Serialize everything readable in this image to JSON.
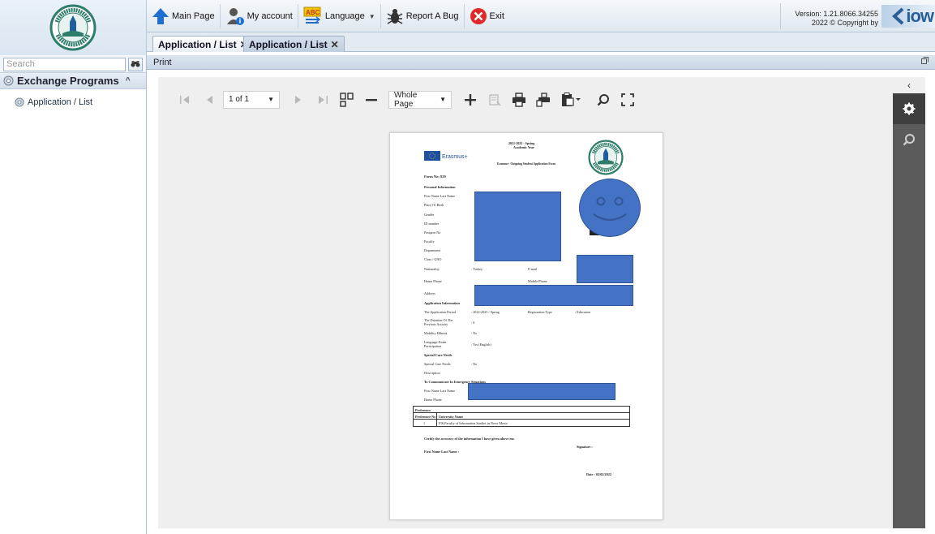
{
  "sidebar": {
    "search_placeholder": "Search",
    "group_label": "Exchange Programs",
    "item_label": "Application /  List"
  },
  "toolbar": {
    "main_page": "Main Page",
    "my_account": "My account",
    "language": "Language",
    "report_bug": "Report A Bug",
    "exit": "Exit"
  },
  "version": {
    "line1": "Version: 1.21.8066.34255",
    "line2": "2022 © Copyright by",
    "brand": "iow"
  },
  "tabs": [
    {
      "label": "Application / List",
      "close": "✕"
    },
    {
      "label": "Application / List",
      "close": "✕"
    }
  ],
  "panel": {
    "title": "Print",
    "close_icon": "restore-icon"
  },
  "viewer": {
    "page_indicator": "1 of 1",
    "zoom_option": "Whole Page"
  },
  "document": {
    "header_line1": "2021-2022 - Spring",
    "header_line2": "Academic Year",
    "erasmus": "Erasmus+",
    "form_title": "Erasmus+ Outgoing Student Application Form",
    "form_no": "Form No: 929",
    "personal_info": "Personal Information",
    "labels": [
      "First Name Last Name",
      "Place Of Birth",
      "Gender",
      "ID number",
      "Passport No",
      "Faculty",
      "Department",
      "Class / GNO"
    ],
    "nationality_label": "Nationality",
    "nationality_value": ": Turkey",
    "email_label": "E-mail",
    "home_phone_label": "Home Phone",
    "mobile_phone_label": "Mobile Phone",
    "address_label": "Address",
    "application_info": "Application Information",
    "app_period_label": "The Application Period",
    "app_period_value": ": 2022-2023 / Spring",
    "reg_type_label": "Registration Type",
    "reg_type_value": ": Education",
    "duration_label_1": "The Duration Of The",
    "duration_label_2": "Previous Activity",
    "duration_value": ": 0",
    "mobility_label": "Mobility Hibesiz",
    "mobility_value": ": No",
    "lang_exam_label_1": "Language Exam",
    "lang_exam_label_2": "Participation",
    "lang_exam_value": ": Yes (English)",
    "special_care_header": "Special Care Needs",
    "special_care_label": "Special Care Needs",
    "special_care_value": ": No",
    "description_label": "Description",
    "emergency_header": "To Communicate In Emergency Situations",
    "emergency_name_label": "First Name Last Name",
    "emergency_phone_label": "Home Phone",
    "preference_title": "Preference",
    "preference_col1": "Preference No",
    "preference_col2": "University Name",
    "preference_no": "1",
    "preference_university": "FIS Faculty of Information Studies in Novo Mesto",
    "certify": "Certify the accuracy of the information I have given above me.",
    "signature": "Signature :",
    "first_last_name": "First Name Last Name :",
    "date": "Date :  02/02/2022"
  }
}
